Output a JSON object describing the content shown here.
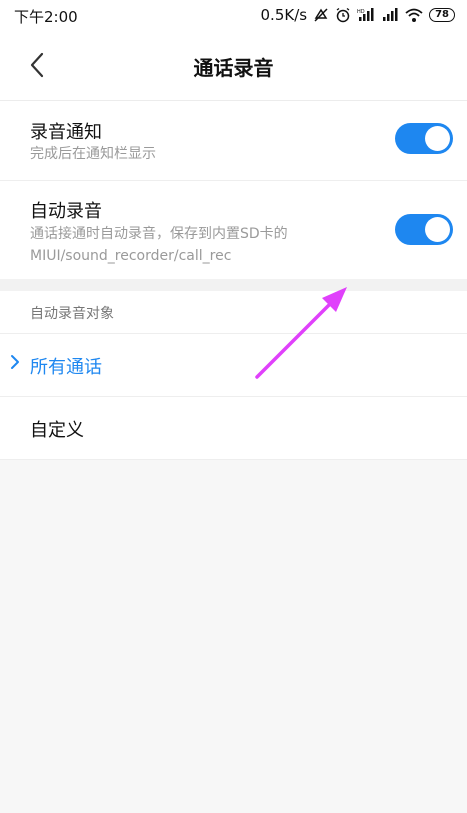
{
  "status_bar": {
    "time": "下午2:00",
    "network_speed": "0.5K/s",
    "battery": "78"
  },
  "header": {
    "title": "通话录音"
  },
  "settings": {
    "notify": {
      "label": "录音通知",
      "sub": "完成后在通知栏显示",
      "enabled": true
    },
    "auto_record": {
      "label": "自动录音",
      "sub": "通话接通时自动录音，保存到内置SD卡的MIUI/sound_recorder/call_rec",
      "enabled": true
    }
  },
  "target_group": {
    "title": "自动录音对象",
    "options": [
      {
        "label": "所有通话",
        "selected": true
      },
      {
        "label": "自定义",
        "selected": false
      }
    ]
  },
  "colors": {
    "accent": "#1e87f0",
    "annotation_arrow": "#e040fb"
  }
}
